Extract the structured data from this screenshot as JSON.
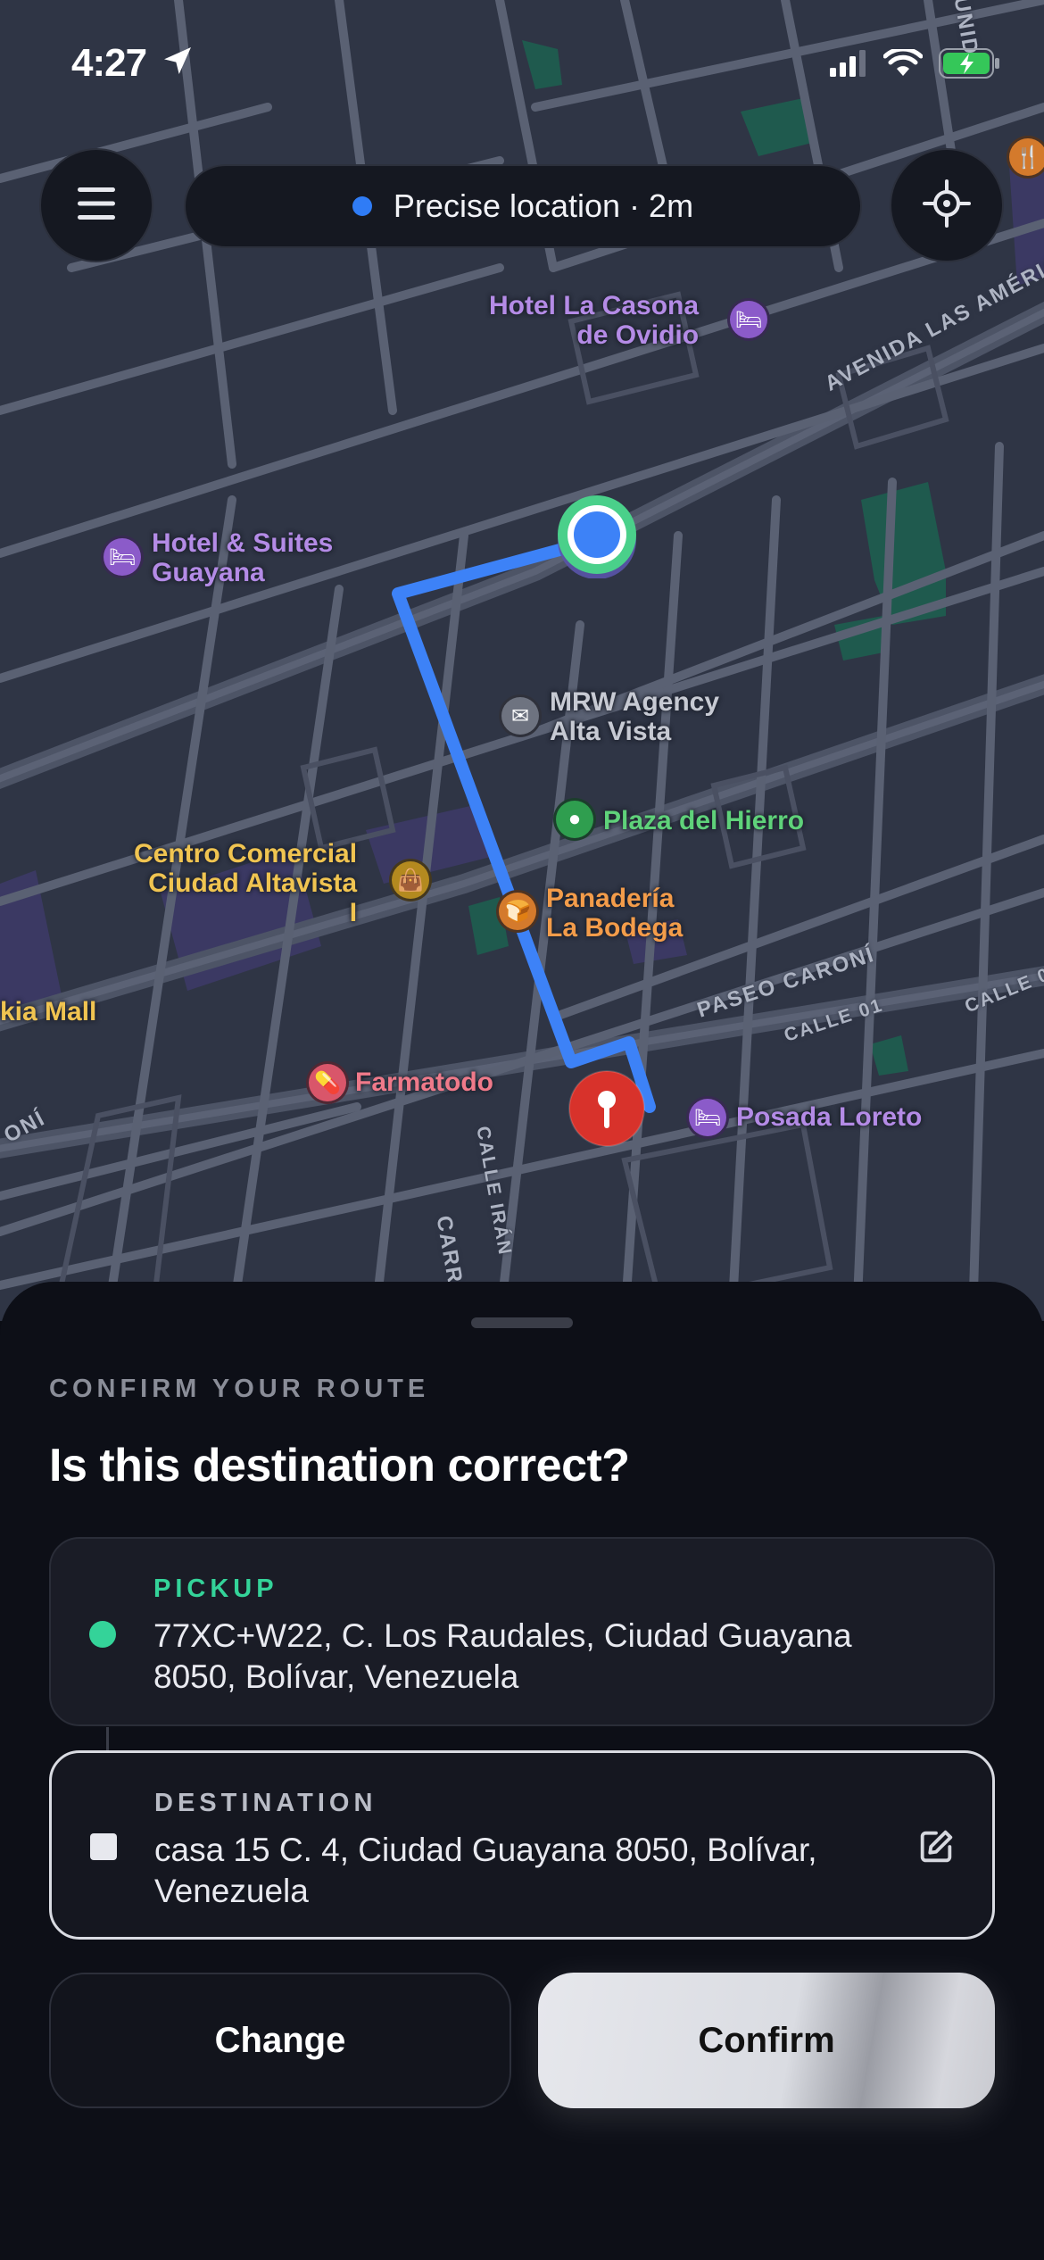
{
  "status_bar": {
    "time": "4:27",
    "icons": [
      "location-arrow-icon",
      "signal-icon",
      "wifi-icon",
      "battery-charging-icon"
    ]
  },
  "top_bar": {
    "menu_icon": "hamburger-menu-icon",
    "location_pill": {
      "text": "Precise location · 2m",
      "dot_color": "#2f7cf6"
    },
    "recenter_icon": "crosshair-icon"
  },
  "map": {
    "places": [
      {
        "id": "hotel-la-casona",
        "name": "Hotel La Casona\nde Ovidio",
        "icon": "bed-icon",
        "color": "#b48be6"
      },
      {
        "id": "hotel-suites-guayana",
        "name": "Hotel & Suites\nGuayana",
        "icon": "bed-icon",
        "color": "#b48be6"
      },
      {
        "id": "mrw-agency",
        "name": "MRW Agency\nAlta Vista",
        "icon": "envelope-icon",
        "color": "#c7cad3"
      },
      {
        "id": "plaza-del-hierro",
        "name": "Plaza del Hierro",
        "icon": "park-icon",
        "color": "#5fd27a"
      },
      {
        "id": "centro-comercial",
        "name": "Centro Comercial\nCiudad Altavista\nI",
        "icon": "shopping-bag-icon",
        "color": "#f0c451"
      },
      {
        "id": "panaderia",
        "name": "Panadería\nLa Bodega",
        "icon": "bread-icon",
        "color": "#f39c4a"
      },
      {
        "id": "kia-mall",
        "name": "kia Mall",
        "icon": "",
        "color": "#f0c451"
      },
      {
        "id": "farmatodo",
        "name": "Farmatodo",
        "icon": "pill-icon",
        "color": "#f07a8a"
      },
      {
        "id": "posada-loreto",
        "name": "Posada Loreto",
        "icon": "bed-icon",
        "color": "#b48be6"
      }
    ],
    "streets": {
      "avenida": "AVENIDA LAS AMÉRIC",
      "paseo": "PASEO CARONÍ",
      "calle01_a": "CALLE 01",
      "calle01_b": "CALLE 0",
      "calle_iran": "CALLE IRÁN",
      "carr": "CARR",
      "unid": "UNID",
      "oni": "ONÍ"
    },
    "route_color": "#3d82f7",
    "pickup_marker": "current-location-marker",
    "destination_marker": "destination-pin-icon"
  },
  "sheet": {
    "eyebrow": "CONFIRM YOUR ROUTE",
    "title": "Is this destination correct?",
    "pickup": {
      "caption": "PICKUP",
      "address": "77XC+W22, C. Los Raudales, Ciudad Guayana 8050, Bolívar, Venezuela",
      "color": "#34d399"
    },
    "destination": {
      "caption": "DESTINATION",
      "address": "casa 15 C. 4, Ciudad Guayana 8050, Bolívar, Venezuela",
      "edit_icon": "edit-icon"
    },
    "buttons": {
      "change": "Change",
      "confirm": "Confirm"
    }
  }
}
